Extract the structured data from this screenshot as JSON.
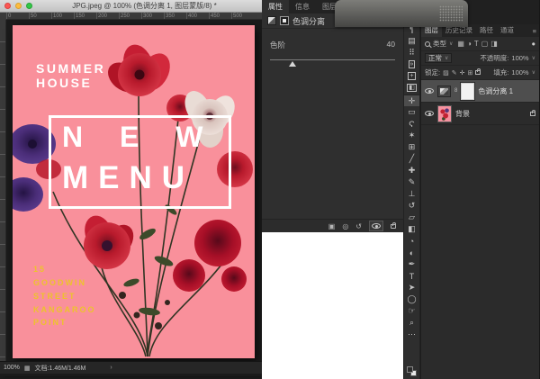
{
  "window": {
    "title": "JPG.jpeg @ 100% (色调分离 1, 图层蒙版/8) *"
  },
  "icons": {
    "caret_down": "∨",
    "panel_menu": "≡",
    "chevron_right": "›",
    "filter_dot": "●",
    "link": "8",
    "clip": "▣",
    "prev_state": "◎",
    "reset": "↺",
    "status_thumb": "▦"
  },
  "canvas": {
    "ruler_labels": [
      "0",
      "50",
      "100",
      "150",
      "200",
      "250",
      "300",
      "350",
      "400",
      "450",
      "500"
    ],
    "status": {
      "zoom": "100%",
      "doc_info": "文档:1.46M/1.46M"
    },
    "poster": {
      "title_line1": "SUMMER",
      "title_line2": "HOUSE",
      "menu_line1": "N E W",
      "menu_line2": "MENU",
      "address_lines": [
        "15",
        "GOODWIN",
        "STREET",
        "KANGAROO",
        "POINT"
      ],
      "colors": {
        "bg": "#f9909b",
        "accent_yellow": "#edc32b",
        "text": "#ffffff"
      }
    }
  },
  "properties_panel": {
    "tabs": [
      {
        "label": "属性",
        "active": true
      },
      {
        "label": "信息",
        "active": false
      },
      {
        "label": "图层复合",
        "active": false
      }
    ],
    "adjustment_title": "色调分离",
    "levels_label": "色阶",
    "levels_value": "40"
  },
  "layers_panel": {
    "tabs": [
      {
        "label": "图层",
        "active": true
      },
      {
        "label": "历史记录",
        "active": false
      },
      {
        "label": "路径",
        "active": false
      },
      {
        "label": "通道",
        "active": false
      }
    ],
    "filter_label": "类型",
    "filter_icons": [
      {
        "n": "filter-pixel-icon",
        "g": "▦"
      },
      {
        "n": "filter-adjustment-icon",
        "g": "◑"
      },
      {
        "n": "filter-type-icon",
        "g": "T"
      },
      {
        "n": "filter-shape-icon",
        "g": "▢"
      },
      {
        "n": "filter-smart-object-icon",
        "g": "◨"
      }
    ],
    "blend_mode": "正常",
    "opacity_label": "不透明度:",
    "opacity_value": "100%",
    "lock_label": "锁定:",
    "lock_icons": [
      {
        "n": "lock-transparency-icon",
        "g": "▨"
      },
      {
        "n": "lock-pixels-icon",
        "g": "✎"
      },
      {
        "n": "lock-position-icon",
        "g": "✛"
      },
      {
        "n": "lock-artboard-icon",
        "g": "⊞"
      }
    ],
    "fill_label": "填充:",
    "fill_value": "100%",
    "layers": [
      {
        "name": "色调分离 1",
        "type": "adjustment",
        "selected": true
      },
      {
        "name": "背景",
        "type": "image",
        "locked": true
      }
    ]
  },
  "dock": {
    "items": [
      {
        "n": "adjustments-panel-icon",
        "g": "≡"
      },
      {
        "n": "character-panel-icon",
        "g": "A"
      },
      {
        "n": "paragraph-panel-icon",
        "g": "¶"
      },
      {
        "n": "styles-panel-icon",
        "g": "▤"
      },
      {
        "n": "swatches-panel-icon",
        "g": "⠿"
      },
      {
        "n": "collapse-panels-icon",
        "g": "»",
        "boxed": true
      },
      {
        "n": "add-panel-icon",
        "g": "+",
        "boxed": true
      },
      {
        "n": "split-panel-icon",
        "g": "◧",
        "boxed": true
      },
      {
        "n": "move-tool",
        "g": "✛",
        "sel": true
      },
      {
        "n": "marquee-tool",
        "g": "▭"
      },
      {
        "n": "lasso-tool",
        "g": "Ϛ"
      },
      {
        "n": "magic-wand-tool",
        "g": "✶"
      },
      {
        "n": "crop-tool",
        "g": "⊞"
      },
      {
        "n": "eyedropper-tool",
        "g": "╱"
      },
      {
        "n": "healing-brush-tool",
        "g": "✚"
      },
      {
        "n": "brush-tool",
        "g": "✎"
      },
      {
        "n": "clone-stamp-tool",
        "g": "⊥"
      },
      {
        "n": "history-brush-tool",
        "g": "↺"
      },
      {
        "n": "eraser-tool",
        "g": "▱"
      },
      {
        "n": "gradient-tool",
        "g": "◧"
      },
      {
        "n": "blur-tool",
        "g": "◔"
      },
      {
        "n": "dodge-tool",
        "g": "◐"
      },
      {
        "n": "pen-tool",
        "g": "✒"
      },
      {
        "n": "type-tool",
        "g": "T"
      },
      {
        "n": "path-select-tool",
        "g": "➤"
      },
      {
        "n": "shape-tool",
        "g": "◯"
      },
      {
        "n": "hand-tool",
        "g": "☞"
      },
      {
        "n": "zoom-tool",
        "g": "⌕"
      },
      {
        "n": "more-tools-icon",
        "g": "⋯"
      }
    ]
  }
}
